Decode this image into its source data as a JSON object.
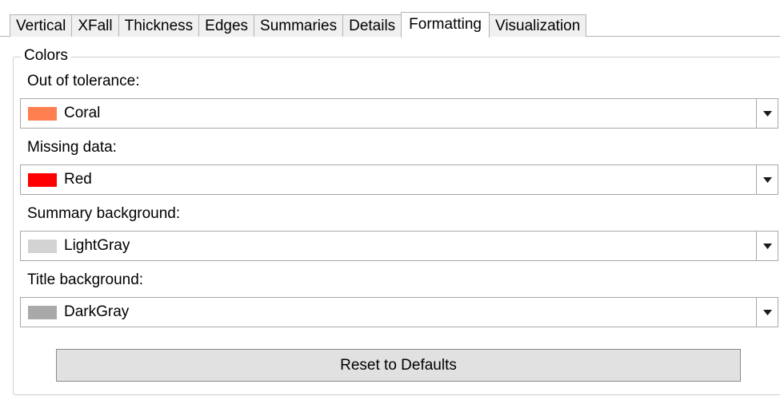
{
  "tabs": [
    {
      "label": "Vertical"
    },
    {
      "label": "XFall"
    },
    {
      "label": "Thickness"
    },
    {
      "label": "Edges"
    },
    {
      "label": "Summaries"
    },
    {
      "label": "Details"
    },
    {
      "label": "Formatting",
      "active": true
    },
    {
      "label": "Visualization"
    }
  ],
  "colors_group": {
    "title": "Colors",
    "fields": [
      {
        "label": "Out of tolerance:",
        "value": "Coral",
        "swatch": "#FF7F50",
        "icon": "chevron-down-icon"
      },
      {
        "label": "Missing data:",
        "value": "Red",
        "swatch": "#FF0000",
        "icon": "chevron-down-icon"
      },
      {
        "label": "Summary background:",
        "value": "LightGray",
        "swatch": "#D3D3D3",
        "icon": "chevron-down-icon"
      },
      {
        "label": "Title background:",
        "value": "DarkGray",
        "swatch": "#A9A9A9",
        "icon": "chevron-down-icon"
      }
    ]
  },
  "reset_button_label": "Reset to Defaults"
}
